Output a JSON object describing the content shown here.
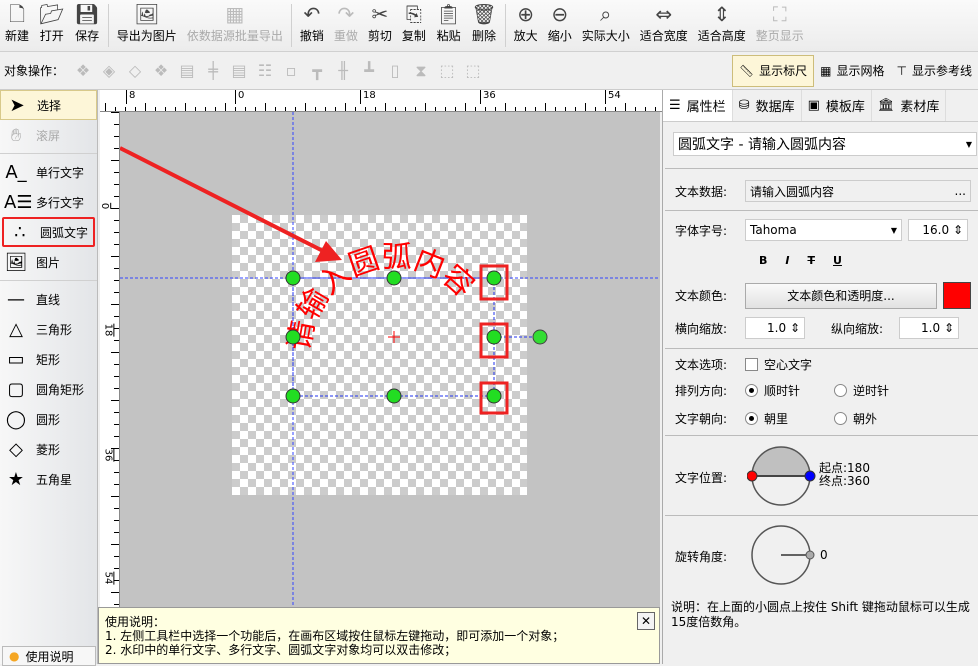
{
  "toolbar": [
    {
      "icon": "new-icon",
      "label": "新建"
    },
    {
      "icon": "open-icon",
      "label": "打开"
    },
    {
      "icon": "save-icon",
      "label": "保存"
    },
    {
      "icon": "export-image-icon",
      "label": "导出为图片"
    },
    {
      "icon": "batch-export-icon",
      "label": "依数据源批量导出",
      "disabled": true
    },
    {
      "icon": "undo-icon",
      "label": "撤销"
    },
    {
      "icon": "redo-icon",
      "label": "重做",
      "disabled": true
    },
    {
      "icon": "cut-icon",
      "label": "剪切"
    },
    {
      "icon": "copy-icon",
      "label": "复制"
    },
    {
      "icon": "paste-icon",
      "label": "粘贴"
    },
    {
      "icon": "delete-icon",
      "label": "删除"
    },
    {
      "icon": "zoom-in-icon",
      "label": "放大"
    },
    {
      "icon": "zoom-out-icon",
      "label": "缩小"
    },
    {
      "icon": "actual-size-icon",
      "label": "实际大小"
    },
    {
      "icon": "fit-width-icon",
      "label": "适合宽度"
    },
    {
      "icon": "fit-height-icon",
      "label": "适合高度"
    },
    {
      "icon": "fit-page-icon",
      "label": "整页显示",
      "disabled": true
    }
  ],
  "object_ops_label": "对象操作：",
  "toggles": {
    "ruler": "显示标尺",
    "grid": "显示网格",
    "guides": "显示参考线"
  },
  "tools": [
    {
      "icon": "select-icon",
      "label": "选择",
      "selected": true
    },
    {
      "icon": "pan-icon",
      "label": "滚屏",
      "disabled": true
    },
    {
      "icon": "single-line-text-icon",
      "label": "单行文字"
    },
    {
      "icon": "multi-line-text-icon",
      "label": "多行文字"
    },
    {
      "icon": "arc-text-icon",
      "label": "圆弧文字"
    },
    {
      "icon": "image-icon",
      "label": "图片"
    },
    {
      "icon": "line-icon",
      "label": "直线"
    },
    {
      "icon": "triangle-icon",
      "label": "三角形"
    },
    {
      "icon": "rectangle-icon",
      "label": "矩形"
    },
    {
      "icon": "rounded-rectangle-icon",
      "label": "圆角矩形"
    },
    {
      "icon": "ellipse-icon",
      "label": "圆形"
    },
    {
      "icon": "diamond-icon",
      "label": "菱形"
    },
    {
      "icon": "star-icon",
      "label": "五角星"
    }
  ],
  "help_button": "使用说明",
  "ruler": {
    "top": [
      "8",
      "0",
      "18",
      "36",
      "54"
    ],
    "left": [
      "0",
      "18",
      "36",
      "54"
    ]
  },
  "canvas": {
    "arc_text": "请输入圆弧内容",
    "text_color": "#ff0000"
  },
  "help": {
    "title": "使用说明：",
    "lines": [
      "1. 左侧工具栏中选择一个功能后，在画布区域按住鼠标左键拖动，即可添加一个对象；",
      "2. 水印中的单行文字、多行文字、圆弧文字对象均可以双击修改；"
    ]
  },
  "panel": {
    "tabs": [
      "属性栏",
      "数据库",
      "模板库",
      "素材库"
    ],
    "object_select": "圆弧文字 - 请输入圆弧内容",
    "text_data_label": "文本数据:",
    "text_data": "请输入圆弧内容",
    "ellipsis": "...",
    "font_label": "字体字号:",
    "font": "Tahoma",
    "font_size": "16.0",
    "style_buttons": [
      "B",
      "I",
      "T",
      "U"
    ],
    "color_label": "文本颜色:",
    "color_button": "文本颜色和透明度...",
    "color": "#ff0000",
    "hscale_label": "横向缩放:",
    "hscale": "1.0",
    "vscale_label": "纵向缩放:",
    "vscale": "1.0",
    "options_label": "文本选项:",
    "hollow": "空心文字",
    "direction_label": "排列方向:",
    "clockwise": "顺时针",
    "counter": "逆时针",
    "facing_label": "文字朝向:",
    "inward": "朝里",
    "outward": "朝外",
    "position_label": "文字位置:",
    "start": "起点:180",
    "end": "终点:360",
    "rotation_label": "旋转角度:",
    "rotation": "0",
    "note": "说明：在上面的小圆点上按住 Shift 键拖动鼠标可以生成15度倍数角。"
  }
}
